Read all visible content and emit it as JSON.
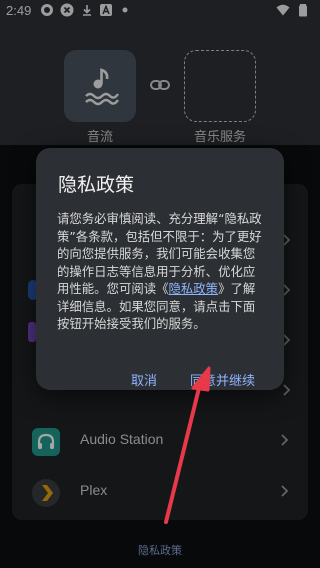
{
  "status_bar": {
    "time": "2:49",
    "icons": [
      "dark-circle-icon",
      "block-x-icon",
      "download-icon",
      "a-box-icon",
      "dot-icon",
      "wifi-icon",
      "battery-icon"
    ]
  },
  "header": {
    "source_label": "音流",
    "target_label": "音乐服务"
  },
  "list": {
    "items": [
      {
        "label": "Audio Station",
        "icon": "headphones-icon"
      },
      {
        "label": "Plex",
        "icon": "plex-chevron-icon"
      }
    ]
  },
  "footer": {
    "privacy_link": "隐私政策"
  },
  "dialog": {
    "title": "隐私政策",
    "body_pre": "请您务必审慎阅读、充分理解“隐私政策”各条款，包括但不限于：为了更好的向您提供服务，我们可能会收集您的操作日志等信息用于分析、优化应用性能。您可阅读《",
    "body_link": "隐私政策",
    "body_post": "》了解详细信息。如果您同意，请点击下面按钮开始接受我们的服务。",
    "cancel_label": "取消",
    "agree_label": "同意并继续"
  },
  "colors": {
    "accent": "#8fb4ff",
    "arrow": "#e8394a",
    "audio_station": "#1f9a8e",
    "plex": "#e5a00d"
  }
}
